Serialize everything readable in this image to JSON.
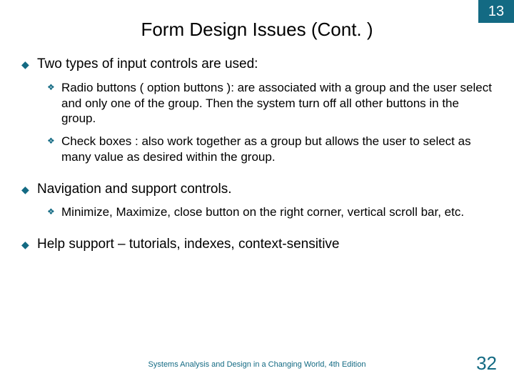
{
  "header": {
    "badge": "13",
    "title": "Form Design Issues (Cont. )"
  },
  "bullets": {
    "b1": "Two types of input controls are used:",
    "b1_1": "Radio buttons ( option buttons ): are associated with a group and the user select and only one of the group. Then the system turn off all other buttons in the group.",
    "b1_2": "Check boxes : also work together as a group but allows the user to select as many value as desired within the group.",
    "b2": "Navigation and support controls.",
    "b2_1": " Minimize, Maximize, close button on the right corner, vertical scroll bar, etc.",
    "b3": "Help support – tutorials, indexes, context-sensitive"
  },
  "footer": {
    "text": "Systems Analysis and Design in a Changing World, 4th Edition",
    "page": "32"
  },
  "glyphs": {
    "diamond": "◆",
    "clover": "❖"
  }
}
